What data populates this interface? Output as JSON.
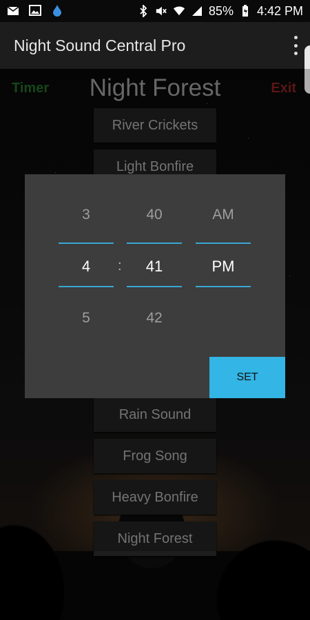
{
  "status_bar": {
    "battery": "85%",
    "time": "4:42 PM",
    "left_icons": [
      "mail-check-icon",
      "image-icon",
      "water-drop-icon"
    ],
    "right_icons": [
      "bluetooth-icon",
      "mute-icon",
      "wifi-icon",
      "signal-icon",
      "battery-icon"
    ]
  },
  "app_bar": {
    "title": "Night Sound Central Pro",
    "menu_icon": "overflow-menu-icon"
  },
  "screen": {
    "timer_label": "Timer",
    "title": "Night Forest",
    "exit_label": "Exit",
    "timer_color": "#1e5e22",
    "exit_color": "#7a1d1d"
  },
  "sound_buttons": [
    "River Crickets",
    "Light Bonfire",
    "Rain Sound",
    "Frog Song",
    "Heavy Bonfire",
    "Night Forest"
  ],
  "time_picker": {
    "hour": {
      "prev": "3",
      "current": "4",
      "next": "5"
    },
    "minute": {
      "prev": "40",
      "current": "41",
      "next": "42"
    },
    "ampm": {
      "prev": "AM",
      "current": "PM"
    },
    "separator": ":",
    "set_label": "SET",
    "accent_color": "#33b5e5"
  }
}
